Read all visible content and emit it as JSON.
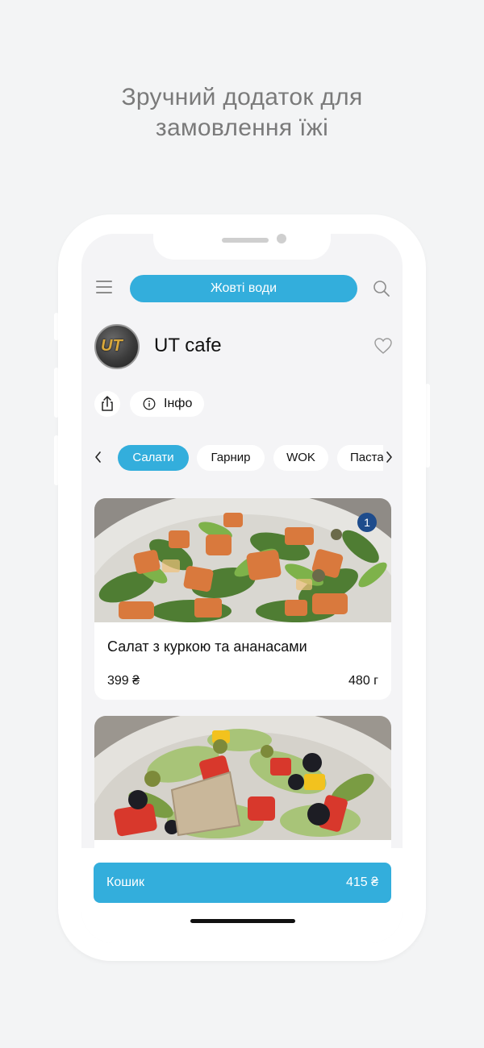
{
  "headline": {
    "line1": "Зручний додаток для",
    "line2": "замовлення їжі"
  },
  "topbar": {
    "location_label": "Жовті води"
  },
  "restaurant": {
    "logo_text": "UT",
    "name": "UT cafe",
    "info_label": "Інфо"
  },
  "categories": [
    {
      "label": "Салати",
      "active": true
    },
    {
      "label": "Гарнир",
      "active": false
    },
    {
      "label": "WOK",
      "active": false
    },
    {
      "label": "Паста",
      "active": false
    }
  ],
  "dishes": [
    {
      "title": "Салат з куркою та ананасами",
      "price": "399 ₴",
      "weight": "480 г",
      "badge": "1"
    },
    {
      "title": "",
      "price": "",
      "weight": "",
      "badge": ""
    }
  ],
  "cart": {
    "label": "Кошик",
    "total": "415 ₴"
  },
  "colors": {
    "accent": "#33aedc",
    "badge": "#1e4c8c",
    "background": "#f3f4f5"
  },
  "icons": [
    "menu-icon",
    "search-icon",
    "heart-icon",
    "share-icon",
    "info-icon",
    "chevron-left-icon",
    "chevron-right-icon"
  ]
}
